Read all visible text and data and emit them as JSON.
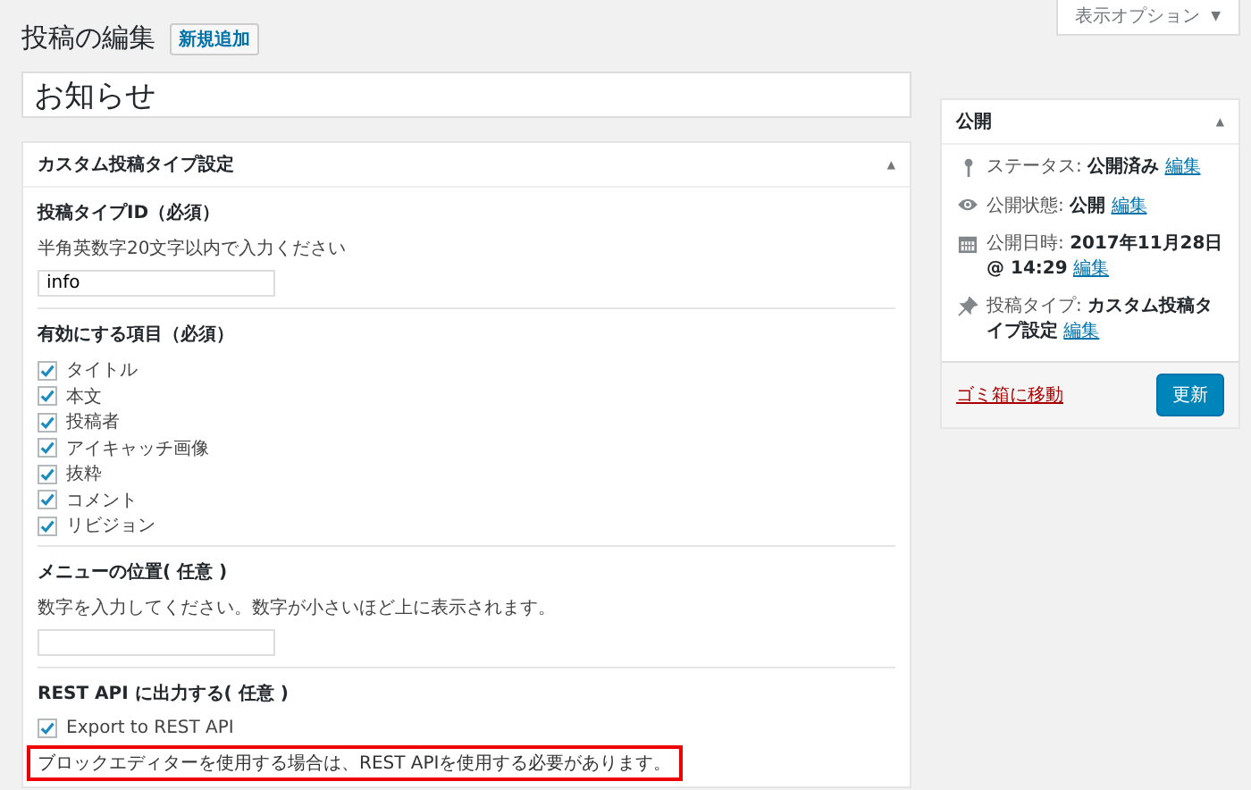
{
  "header": {
    "title": "投稿の編集",
    "add_new": "新規追加"
  },
  "screen_options": {
    "label": "表示オプション",
    "caret": "▼"
  },
  "post_title": {
    "value": "お知らせ"
  },
  "meta_box": {
    "title": "カスタム投稿タイプ設定",
    "toggle": "▲",
    "sections": [
      {
        "kind": "text_field",
        "heading": "投稿タイプID（必須）",
        "description": "半角英数字20文字以内で入力ください",
        "value": "info"
      },
      {
        "kind": "checklist",
        "heading": "有効にする項目（必須）",
        "items": [
          {
            "label": "タイトル",
            "checked": true
          },
          {
            "label": "本文",
            "checked": true
          },
          {
            "label": "投稿者",
            "checked": true
          },
          {
            "label": "アイキャッチ画像",
            "checked": true
          },
          {
            "label": "抜粋",
            "checked": true
          },
          {
            "label": "コメント",
            "checked": true
          },
          {
            "label": "リビジョン",
            "checked": true
          }
        ]
      },
      {
        "kind": "text_field",
        "heading": "メニューの位置( 任意 )",
        "description": "数字を入力してください。数字が小さいほど上に表示されます。"
      },
      {
        "kind": "checklist",
        "heading": "REST API に出力する( 任意 )",
        "items": [
          {
            "label": "Export to REST API",
            "checked": true
          }
        ],
        "note": {
          "text": "ブロックエディターを使用する場合は、REST APIを使用する必要があります。",
          "highlighted": true
        }
      }
    ]
  },
  "publish_box": {
    "title": "公開",
    "toggle": "▲",
    "items": [
      {
        "kind": "status",
        "label": "ステータス:",
        "value": "公開済み",
        "link": "編集"
      },
      {
        "kind": "visibility",
        "label": "公開状態:",
        "value": "公開",
        "link": "編集"
      },
      {
        "kind": "date",
        "label": "公開日時:",
        "value": "2017年11月28日 @ 14:29",
        "link": "編集"
      },
      {
        "kind": "post_type",
        "label": "投稿タイプ:",
        "value": "カスタム投稿タイプ設定",
        "link": "編集"
      }
    ],
    "trash_link": "ゴミ箱に移動",
    "update_button": "更新"
  }
}
